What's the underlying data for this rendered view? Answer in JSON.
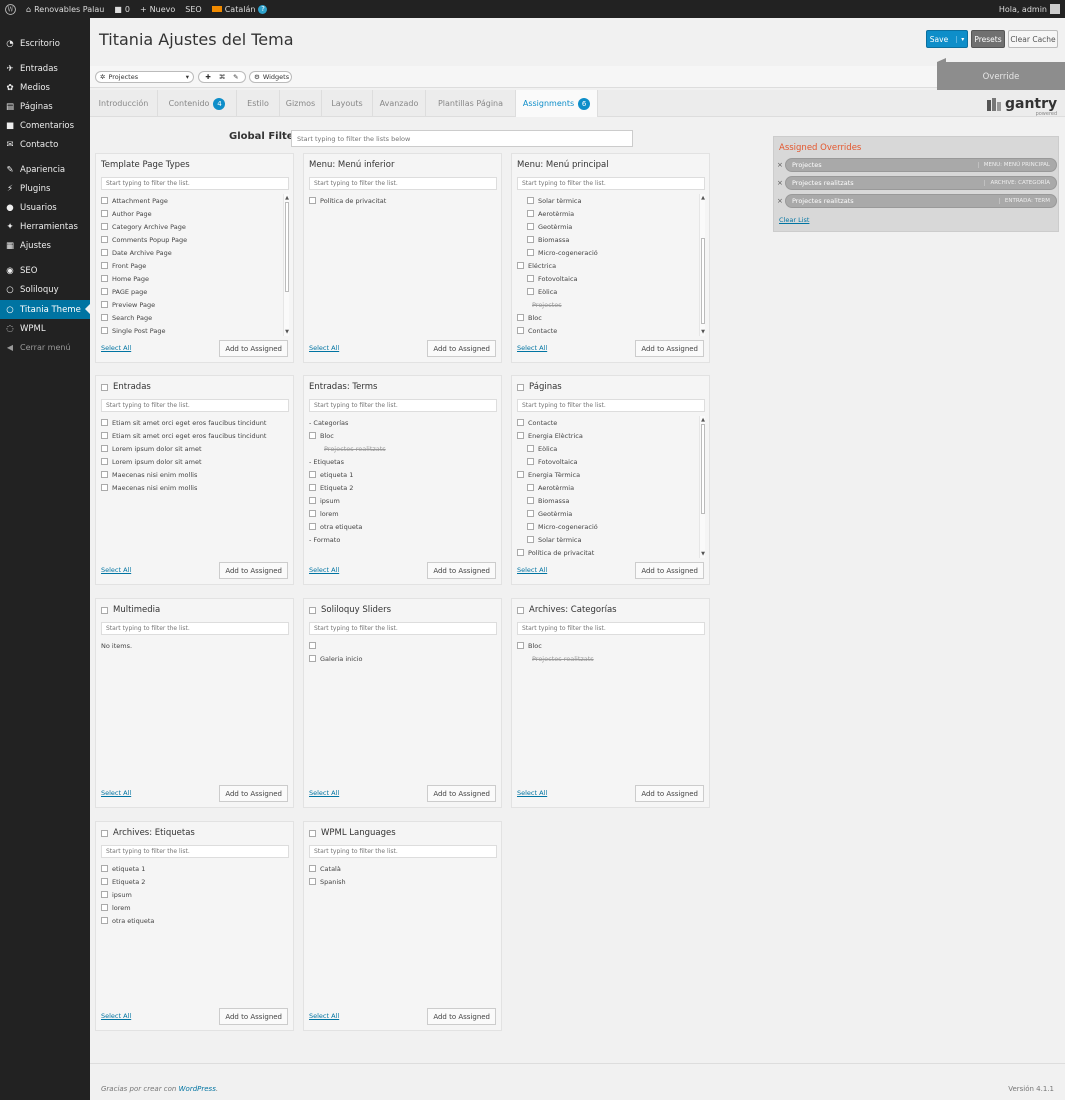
{
  "admin_bar": {
    "site_name": "Renovables Palau",
    "comments_count": "0",
    "new_label": "Nuevo",
    "seo_label": "SEO",
    "language_label": "Catalán",
    "greeting": "Hola, admin"
  },
  "sidebar": {
    "items": [
      {
        "label": "Escritorio",
        "icon": "dashboard-icon"
      },
      {
        "label": "Entradas",
        "icon": "pin-icon"
      },
      {
        "label": "Medios",
        "icon": "media-icon"
      },
      {
        "label": "Páginas",
        "icon": "page-icon"
      },
      {
        "label": "Comentarios",
        "icon": "comment-icon"
      },
      {
        "label": "Contacto",
        "icon": "mail-icon"
      },
      {
        "label": "Apariencia",
        "icon": "brush-icon"
      },
      {
        "label": "Plugins",
        "icon": "plugin-icon"
      },
      {
        "label": "Usuarios",
        "icon": "user-icon"
      },
      {
        "label": "Herramientas",
        "icon": "wrench-icon"
      },
      {
        "label": "Ajustes",
        "icon": "settings-icon"
      },
      {
        "label": "SEO",
        "icon": "seo-icon"
      },
      {
        "label": "Soliloquy",
        "icon": "ring-icon"
      },
      {
        "label": "Titania Theme",
        "icon": "ring-icon"
      },
      {
        "label": "WPML",
        "icon": "wpml-icon"
      },
      {
        "label": "Cerrar menú",
        "icon": "collapse-icon"
      }
    ]
  },
  "page": {
    "title": "Titania Ajustes del Tema",
    "save_label": "Save",
    "presets_label": "Presets",
    "clear_cache_label": "Clear Cache"
  },
  "toolbar": {
    "override_select": "Projectes",
    "widgets_label": "Widgets",
    "override_label": "Override"
  },
  "tabs": [
    {
      "label": "Introducción",
      "badge": ""
    },
    {
      "label": "Contenido",
      "badge": "4"
    },
    {
      "label": "Estilo",
      "badge": ""
    },
    {
      "label": "Gizmos",
      "badge": ""
    },
    {
      "label": "Layouts",
      "badge": ""
    },
    {
      "label": "Avanzado",
      "badge": ""
    },
    {
      "label": "Plantillas Página",
      "badge": ""
    },
    {
      "label": "Assignments",
      "badge": "6"
    }
  ],
  "logo": {
    "text": "gantry",
    "sub": "powered"
  },
  "global_filter": {
    "label": "Global Filter",
    "placeholder": "Start typing to filter the lists below"
  },
  "common": {
    "filter_placeholder": "Start typing to filter the list.",
    "select_all": "Select All",
    "add_to_assigned": "Add to Assigned"
  },
  "panels": [
    {
      "title": "Template Page Types",
      "header_cb": false,
      "scroll": true,
      "items": [
        {
          "t": "Attachment Page"
        },
        {
          "t": "Author Page"
        },
        {
          "t": "Category Archive Page"
        },
        {
          "t": "Comments Popup Page"
        },
        {
          "t": "Date Archive Page"
        },
        {
          "t": "Front Page"
        },
        {
          "t": "Home Page"
        },
        {
          "t": "PAGE page"
        },
        {
          "t": "Preview Page"
        },
        {
          "t": "Search Page"
        },
        {
          "t": "Single Post Page"
        }
      ]
    },
    {
      "title": "Menu: Menú inferior",
      "header_cb": false,
      "scroll": false,
      "items": [
        {
          "t": "Política de privacitat"
        }
      ]
    },
    {
      "title": "Menu: Menú principal",
      "header_cb": false,
      "scroll": true,
      "items": [
        {
          "t": "Solar tèrmica",
          "k": "child"
        },
        {
          "t": "Aerotèrmia",
          "k": "child"
        },
        {
          "t": "Geotèrmia",
          "k": "child"
        },
        {
          "t": "Biomassa",
          "k": "child"
        },
        {
          "t": "Micro-cogeneració",
          "k": "child"
        },
        {
          "t": "Eléctrica"
        },
        {
          "t": "Fotovoltaica",
          "k": "child"
        },
        {
          "t": "Eòlica",
          "k": "child"
        },
        {
          "t": "Projectes",
          "k": "strike"
        },
        {
          "t": "Bloc"
        },
        {
          "t": "Contacte"
        }
      ]
    },
    {
      "title": "Entradas",
      "header_cb": true,
      "scroll": false,
      "items": [
        {
          "t": "Etiam sit amet orci eget eros faucibus tincidunt"
        },
        {
          "t": "Etiam sit amet orci eget eros faucibus tincidunt"
        },
        {
          "t": "Lorem ipsum dolor sit amet"
        },
        {
          "t": "Lorem ipsum dolor sit amet"
        },
        {
          "t": "Maecenas nisi enim mollis"
        },
        {
          "t": "Maecenas nisi enim mollis"
        }
      ]
    },
    {
      "title": "Entradas: Terms",
      "header_cb": false,
      "scroll": false,
      "items": [
        {
          "t": "- Categorías",
          "k": "grp"
        },
        {
          "t": "Bloc"
        },
        {
          "t": "Projectes realitzats",
          "k": "strike"
        },
        {
          "t": "- Etiquetas",
          "k": "grp"
        },
        {
          "t": "etiqueta 1"
        },
        {
          "t": "Etiqueta 2"
        },
        {
          "t": "ipsum"
        },
        {
          "t": "lorem"
        },
        {
          "t": "otra etiqueta"
        },
        {
          "t": "- Formato",
          "k": "grp"
        }
      ]
    },
    {
      "title": "Páginas",
      "header_cb": true,
      "scroll": true,
      "items": [
        {
          "t": "Contacte"
        },
        {
          "t": "Energia Elèctrica"
        },
        {
          "t": "Eòlica",
          "k": "child"
        },
        {
          "t": "Fotovoltaica",
          "k": "child"
        },
        {
          "t": "Energia Tèrmica"
        },
        {
          "t": "Aerotèrmia",
          "k": "child"
        },
        {
          "t": "Biomassa",
          "k": "child"
        },
        {
          "t": "Geotèrmia",
          "k": "child"
        },
        {
          "t": "Micro-cogeneració",
          "k": "child"
        },
        {
          "t": "Solar tèrmica",
          "k": "child"
        },
        {
          "t": "Política de privacitat"
        }
      ]
    },
    {
      "title": "Multimedia",
      "header_cb": true,
      "scroll": false,
      "items": [
        {
          "t": "No items.",
          "k": "plain"
        }
      ]
    },
    {
      "title": "Soliloquy Sliders",
      "header_cb": true,
      "scroll": false,
      "items": [
        {
          "t": ""
        },
        {
          "t": "Galeria inicio"
        }
      ]
    },
    {
      "title": "Archives: Categorías",
      "header_cb": true,
      "scroll": false,
      "items": [
        {
          "t": "Bloc"
        },
        {
          "t": "Projectes realitzats",
          "k": "strike"
        }
      ]
    },
    {
      "title": "Archives: Etiquetas",
      "header_cb": true,
      "scroll": false,
      "items": [
        {
          "t": "etiqueta 1"
        },
        {
          "t": "Etiqueta 2"
        },
        {
          "t": "ipsum"
        },
        {
          "t": "lorem"
        },
        {
          "t": "otra etiqueta"
        }
      ]
    },
    {
      "title": "WPML Languages",
      "header_cb": true,
      "scroll": false,
      "items": [
        {
          "t": "Català"
        },
        {
          "t": "Spanish"
        }
      ]
    }
  ],
  "assigned": {
    "title": "Assigned Overrides",
    "rows": [
      {
        "name": "Projectes",
        "tag": "MENU: MENÚ PRINCIPAL"
      },
      {
        "name": "Projectes realitzats",
        "tag": "ARCHIVE: CATEGORÍA"
      },
      {
        "name": "Projectes realitzats",
        "tag": "ENTRADA: TERM"
      }
    ],
    "clear_label": "Clear List"
  },
  "footer": {
    "credit_prefix": "Gracias por crear con ",
    "credit_link": "WordPress",
    "credit_suffix": ".",
    "version": "Versión 4.1.1"
  },
  "colors": {
    "accent": "#0e8ec9",
    "admin_dark": "#222222",
    "assigned_title": "#e4572e"
  }
}
